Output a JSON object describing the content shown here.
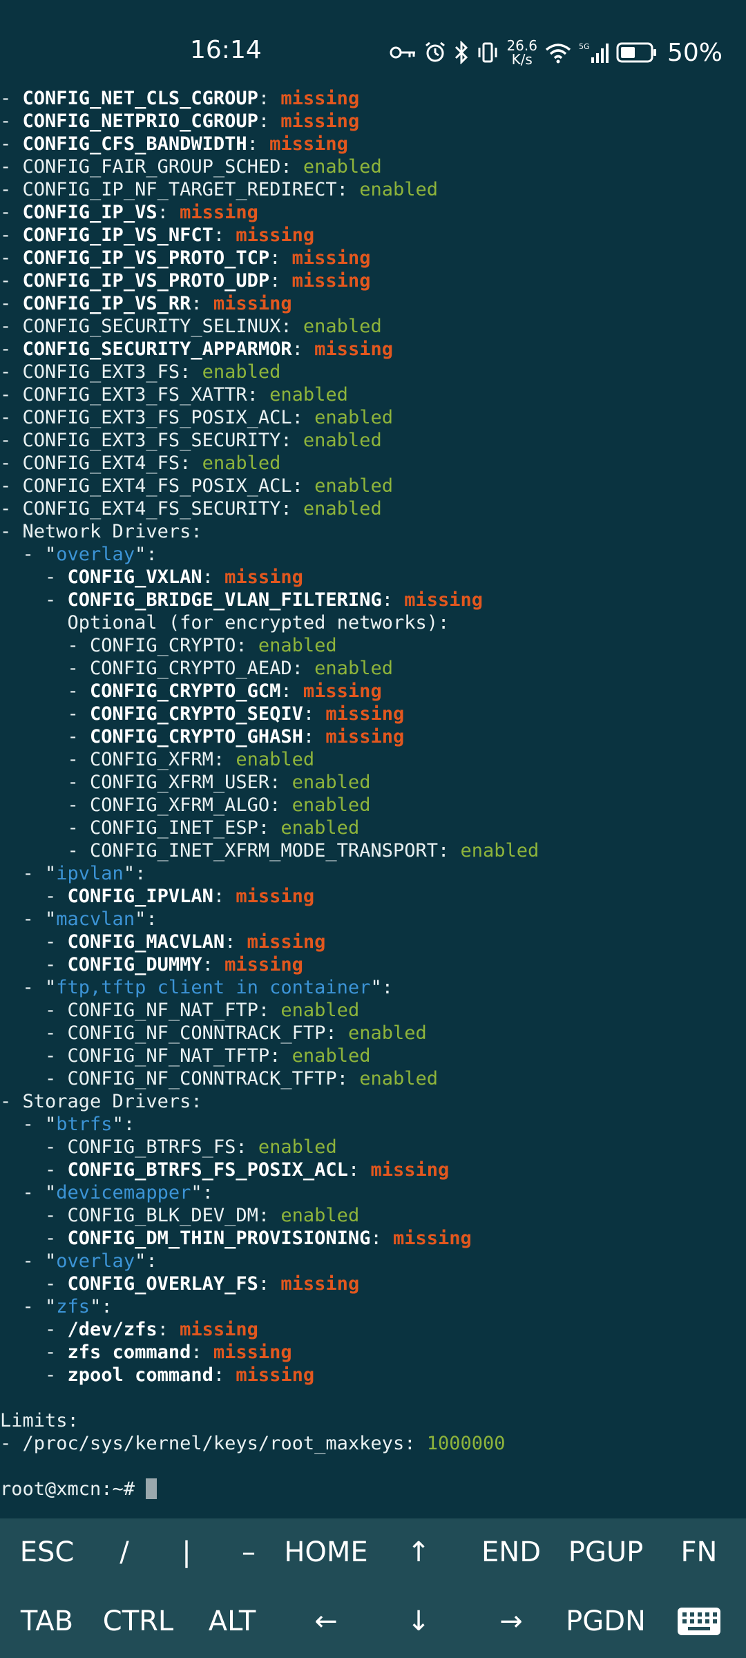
{
  "status_bar": {
    "time": "16:14",
    "net_speed_value": "26.6",
    "net_speed_unit": "K/s",
    "battery_percent": "50%",
    "icons": [
      "key-icon",
      "alarm-icon",
      "bluetooth-icon",
      "vibrate-icon",
      "wifi-icon",
      "signal-5g-icon",
      "battery-icon"
    ]
  },
  "terminal": {
    "lines": [
      {
        "indent": "",
        "text": "CONFIG_NET_CLS_CGROUP",
        "status": "missing"
      },
      {
        "indent": "",
        "text": "CONFIG_NETPRIO_CGROUP",
        "status": "missing"
      },
      {
        "indent": "",
        "text": "CONFIG_CFS_BANDWIDTH",
        "status": "missing"
      },
      {
        "indent": "",
        "text": "CONFIG_FAIR_GROUP_SCHED",
        "status": "enabled"
      },
      {
        "indent": "",
        "text": "CONFIG_IP_NF_TARGET_REDIRECT",
        "status": "enabled"
      },
      {
        "indent": "",
        "text": "CONFIG_IP_VS",
        "status": "missing"
      },
      {
        "indent": "",
        "text": "CONFIG_IP_VS_NFCT",
        "status": "missing"
      },
      {
        "indent": "",
        "text": "CONFIG_IP_VS_PROTO_TCP",
        "status": "missing"
      },
      {
        "indent": "",
        "text": "CONFIG_IP_VS_PROTO_UDP",
        "status": "missing"
      },
      {
        "indent": "",
        "text": "CONFIG_IP_VS_RR",
        "status": "missing"
      },
      {
        "indent": "",
        "text": "CONFIG_SECURITY_SELINUX",
        "status": "enabled"
      },
      {
        "indent": "",
        "text": "CONFIG_SECURITY_APPARMOR",
        "status": "missing"
      },
      {
        "indent": "",
        "text": "CONFIG_EXT3_FS",
        "status": "enabled"
      },
      {
        "indent": "",
        "text": "CONFIG_EXT3_FS_XATTR",
        "status": "enabled"
      },
      {
        "indent": "",
        "text": "CONFIG_EXT3_FS_POSIX_ACL",
        "status": "enabled"
      },
      {
        "indent": "",
        "text": "CONFIG_EXT3_FS_SECURITY",
        "status": "enabled"
      },
      {
        "indent": "",
        "text": "CONFIG_EXT4_FS",
        "status": "enabled"
      },
      {
        "indent": "",
        "text": "CONFIG_EXT4_FS_POSIX_ACL",
        "status": "enabled"
      },
      {
        "indent": "",
        "text": "CONFIG_EXT4_FS_SECURITY",
        "status": "enabled"
      },
      {
        "type": "heading",
        "indent": "",
        "text": "- Network Drivers:"
      },
      {
        "type": "group",
        "indent": "  ",
        "name": "overlay"
      },
      {
        "indent": "    ",
        "text": "CONFIG_VXLAN",
        "status": "missing"
      },
      {
        "indent": "    ",
        "text": "CONFIG_BRIDGE_VLAN_FILTERING",
        "status": "missing"
      },
      {
        "type": "plain",
        "indent": "",
        "text": "      Optional (for encrypted networks):"
      },
      {
        "indent": "      ",
        "text": "CONFIG_CRYPTO",
        "status": "enabled"
      },
      {
        "indent": "      ",
        "text": "CONFIG_CRYPTO_AEAD",
        "status": "enabled"
      },
      {
        "indent": "      ",
        "text": "CONFIG_CRYPTO_GCM",
        "status": "missing"
      },
      {
        "indent": "      ",
        "text": "CONFIG_CRYPTO_SEQIV",
        "status": "missing"
      },
      {
        "indent": "      ",
        "text": "CONFIG_CRYPTO_GHASH",
        "status": "missing"
      },
      {
        "indent": "      ",
        "text": "CONFIG_XFRM",
        "status": "enabled"
      },
      {
        "indent": "      ",
        "text": "CONFIG_XFRM_USER",
        "status": "enabled"
      },
      {
        "indent": "      ",
        "text": "CONFIG_XFRM_ALGO",
        "status": "enabled"
      },
      {
        "indent": "      ",
        "text": "CONFIG_INET_ESP",
        "status": "enabled"
      },
      {
        "indent": "      ",
        "text": "CONFIG_INET_XFRM_MODE_TRANSPORT",
        "status": "enabled"
      },
      {
        "type": "group",
        "indent": "  ",
        "name": "ipvlan"
      },
      {
        "indent": "    ",
        "text": "CONFIG_IPVLAN",
        "status": "missing"
      },
      {
        "type": "group",
        "indent": "  ",
        "name": "macvlan"
      },
      {
        "indent": "    ",
        "text": "CONFIG_MACVLAN",
        "status": "missing"
      },
      {
        "indent": "    ",
        "text": "CONFIG_DUMMY",
        "status": "missing"
      },
      {
        "type": "group",
        "indent": "  ",
        "name": "ftp,tftp client in container"
      },
      {
        "indent": "    ",
        "text": "CONFIG_NF_NAT_FTP",
        "status": "enabled"
      },
      {
        "indent": "    ",
        "text": "CONFIG_NF_CONNTRACK_FTP",
        "status": "enabled"
      },
      {
        "indent": "    ",
        "text": "CONFIG_NF_NAT_TFTP",
        "status": "enabled"
      },
      {
        "indent": "    ",
        "text": "CONFIG_NF_CONNTRACK_TFTP",
        "status": "enabled"
      },
      {
        "type": "heading",
        "indent": "",
        "text": "- Storage Drivers:"
      },
      {
        "type": "group",
        "indent": "  ",
        "name": "btrfs"
      },
      {
        "indent": "    ",
        "text": "CONFIG_BTRFS_FS",
        "status": "enabled"
      },
      {
        "indent": "    ",
        "text": "CONFIG_BTRFS_FS_POSIX_ACL",
        "status": "missing"
      },
      {
        "type": "group",
        "indent": "  ",
        "name": "devicemapper"
      },
      {
        "indent": "    ",
        "text": "CONFIG_BLK_DEV_DM",
        "status": "enabled"
      },
      {
        "indent": "    ",
        "text": "CONFIG_DM_THIN_PROVISIONING",
        "status": "missing"
      },
      {
        "type": "group",
        "indent": "  ",
        "name": "overlay"
      },
      {
        "indent": "    ",
        "text": "CONFIG_OVERLAY_FS",
        "status": "missing"
      },
      {
        "type": "group",
        "indent": "  ",
        "name": "zfs"
      },
      {
        "indent": "    ",
        "text": "/dev/zfs",
        "status": "missing"
      },
      {
        "indent": "    ",
        "text": "zfs command",
        "status": "missing"
      },
      {
        "indent": "    ",
        "text": "zpool command",
        "status": "missing"
      },
      {
        "type": "blank"
      },
      {
        "type": "plain",
        "indent": "",
        "text": "Limits:"
      },
      {
        "type": "value",
        "indent": "",
        "text": "- /proc/sys/kernel/keys/root_maxkeys: ",
        "value": "1000000"
      },
      {
        "type": "blank"
      },
      {
        "type": "prompt",
        "text": "root@xmcn:~# "
      }
    ]
  },
  "extra_keys": {
    "row1": [
      "ESC",
      "/",
      "|",
      "–",
      "HOME",
      "↑",
      "END",
      "PGUP",
      "FN"
    ],
    "row2": [
      "TAB",
      "CTRL",
      "ALT",
      "←",
      "↓",
      "→",
      "PGDN",
      "keyboard-icon"
    ]
  },
  "colors": {
    "background": "#0a3340",
    "missing": "#e2571e",
    "enabled": "#8eb43b",
    "group_name": "#3c94d6",
    "keybar": "#214c56"
  }
}
